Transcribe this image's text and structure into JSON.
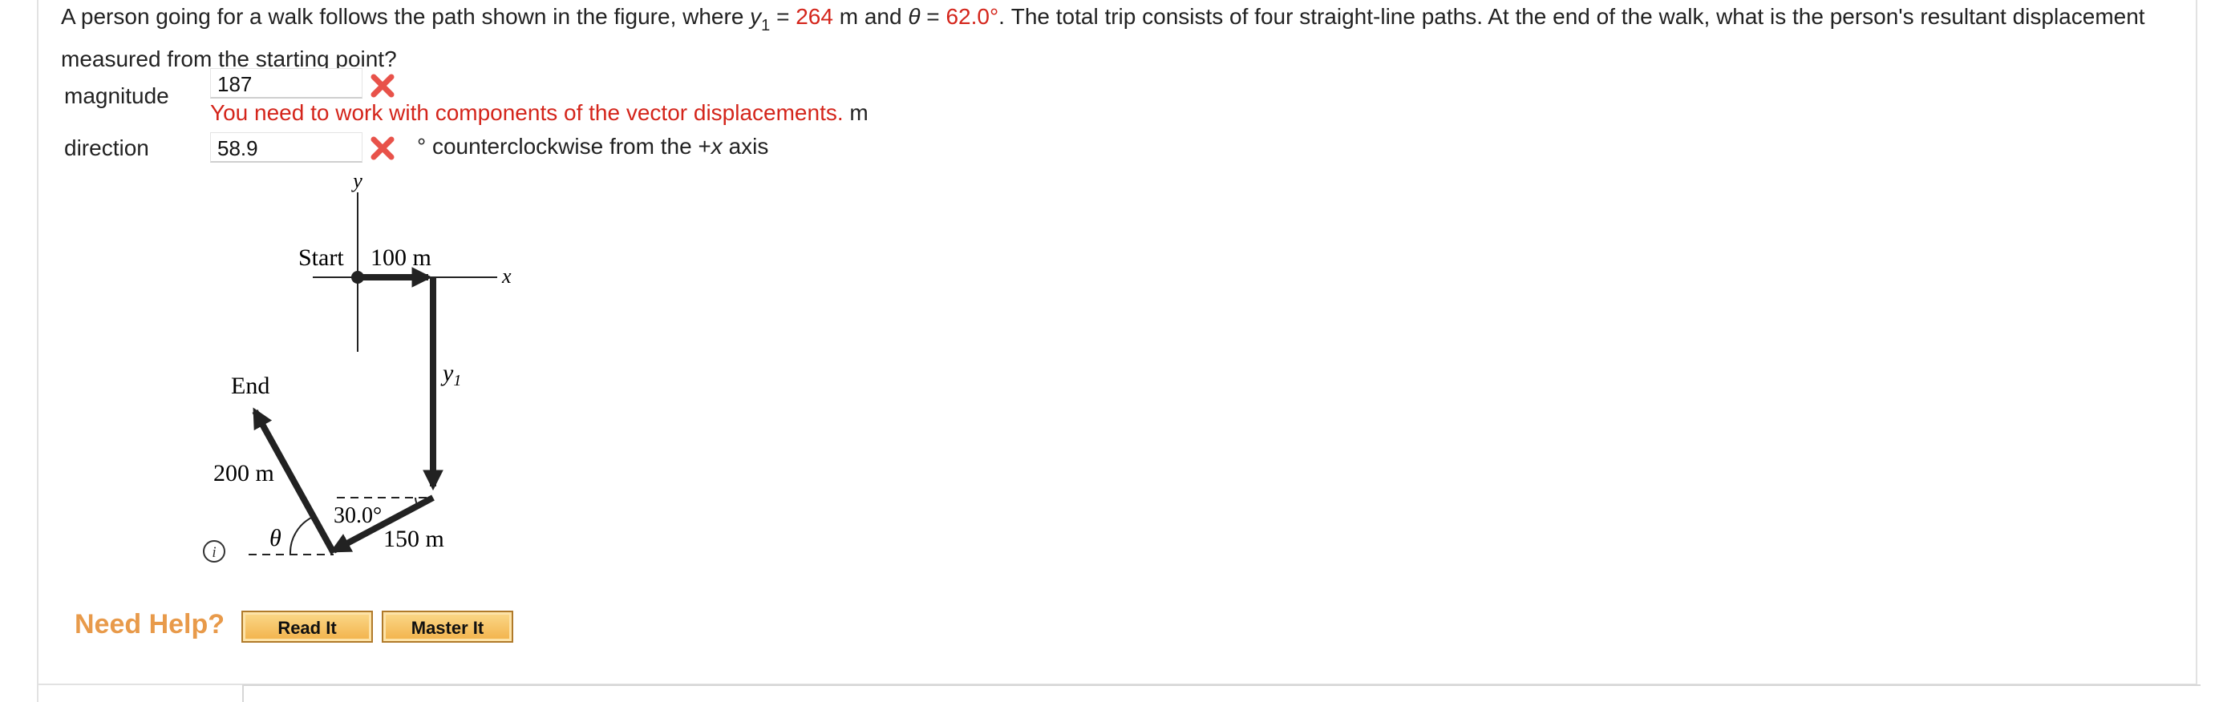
{
  "question": {
    "text_before": "A person going for a walk follows the path shown in the figure, where ",
    "y_var": "y",
    "y_sub": "1",
    "eq1": " = ",
    "y_value": "264",
    "text_mid": " m and ",
    "theta_var": "θ",
    "eq2": " = ",
    "theta_value": "62.0°",
    "text_after": ". The total trip consists of four straight-line paths. At the end of the walk, what is the person's resultant displacement measured from the starting point?"
  },
  "magnitude": {
    "label": "magnitude",
    "value": "187",
    "feedback": "You need to work with components of the vector displacements.",
    "unit": "m"
  },
  "direction": {
    "label": "direction",
    "value": "58.9",
    "unit_prefix": "° counterclockwise from the +",
    "unit_var": "x",
    "unit_suffix": " axis"
  },
  "figure": {
    "axis_y": "y",
    "axis_x": "x",
    "start": "Start",
    "seg1": "100 m",
    "seg2": "y",
    "seg2_sub": "1",
    "angle1": "30.0°",
    "seg3": "150 m",
    "seg4": "200 m",
    "theta": "θ",
    "end": "End"
  },
  "help": {
    "title": "Need Help?",
    "read_it": "Read It",
    "master_it": "Master It"
  },
  "colors": {
    "red": "#d4251b",
    "help_orange": "#e89a4a",
    "button_fill": "#f2b24a"
  }
}
